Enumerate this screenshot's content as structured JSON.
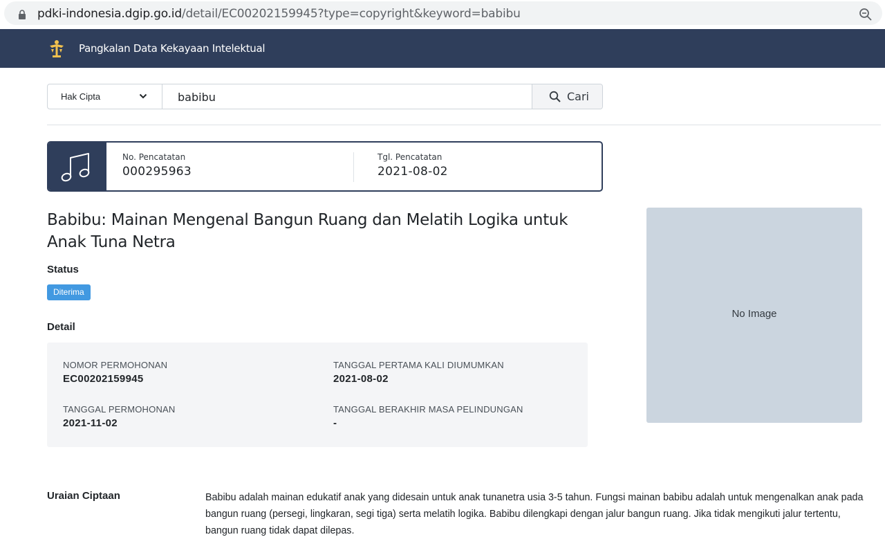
{
  "browser": {
    "url_domain": "pdki-indonesia.dgip.go.id",
    "url_path": "/detail/EC00202159945?type=copyright&keyword=babibu"
  },
  "nav": {
    "brand": "Pangkalan Data Kekayaan Intelektual"
  },
  "search": {
    "type_label": "Hak Cipta",
    "query": "babibu",
    "button_label": "Cari"
  },
  "registration": {
    "number_label": "No. Pencatatan",
    "number_value": "000295963",
    "date_label": "Tgl. Pencatatan",
    "date_value": "2021-08-02"
  },
  "record": {
    "title": "Babibu: Mainan Mengenal Bangun Ruang dan Melatih Logika untuk Anak Tuna Netra",
    "status_heading": "Status",
    "status_badge": "Diterima",
    "detail_heading": "Detail",
    "fields": [
      {
        "label": "NOMOR PERMOHONAN",
        "value": "EC00202159945"
      },
      {
        "label": "TANGGAL PERTAMA KALI DIUMUMKAN",
        "value": "2021-08-02"
      },
      {
        "label": "TANGGAL PERMOHONAN",
        "value": "2021-11-02"
      },
      {
        "label": "TANGGAL BERAKHIR MASA PELINDUNGAN",
        "value": "-"
      }
    ],
    "image_placeholder": "No Image",
    "description_label": "Uraian Ciptaan",
    "description": "Babibu adalah mainan edukatif anak yang didesain untuk anak tunanetra usia 3-5 tahun. Fungsi mainan babibu adalah untuk mengenalkan anak pada bangun ruang (persegi, lingkaran, segi tiga) serta melatih logika. Babibu dilengkapi dengan jalur bangun ruang. Jika tidak mengikuti jalur tertentu, bangun ruang tidak dapat dilepas."
  },
  "colors": {
    "navbar": "#2f3e5b",
    "badge": "#4299e1",
    "detail_bg": "#f4f5f7",
    "image_placeholder_bg": "#cbd5df"
  },
  "icons": [
    "lock-icon",
    "zoom-icon",
    "logo-icon",
    "chevron-down-icon",
    "search-icon",
    "music-note-icon"
  ]
}
